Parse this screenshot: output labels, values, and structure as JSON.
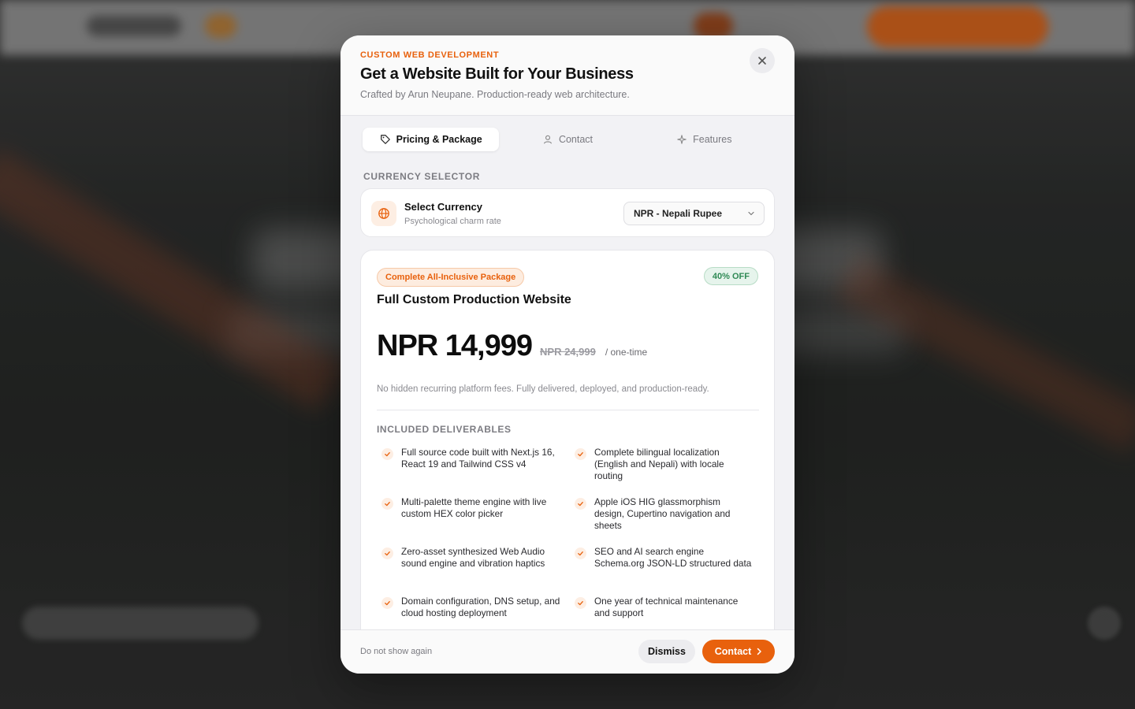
{
  "modal": {
    "eyebrow": "CUSTOM WEB DEVELOPMENT",
    "title": "Get a Website Built for Your Business",
    "subtitle": "Crafted by Arun Neupane. Production-ready web architecture.",
    "close_icon": "close-icon"
  },
  "tabs": [
    {
      "label": "Pricing & Package",
      "icon": "tag-icon",
      "active": true
    },
    {
      "label": "Contact",
      "icon": "user-icon",
      "active": false
    },
    {
      "label": "Features",
      "icon": "sparkle-icon",
      "active": false
    }
  ],
  "currency": {
    "section_label": "CURRENCY SELECTOR",
    "title": "Select Currency",
    "subtitle": "Psychological charm rate",
    "selected": "NPR - Nepali Rupee",
    "icon": "globe-icon"
  },
  "package": {
    "badge": "Complete All-Inclusive Package",
    "discount": "40% OFF",
    "name": "Full Custom Production Website",
    "price": "NPR 14,999",
    "old_price": "NPR 24,999",
    "period": "/ one-time",
    "note": "No hidden recurring platform fees. Fully delivered, deployed, and production-ready.",
    "deliverables_label": "INCLUDED DELIVERABLES",
    "deliverables": [
      "Full source code built with Next.js 16, React 19 and Tailwind CSS v4",
      "Complete bilingual localization (English and Nepali) with locale routing",
      "Multi-palette theme engine with live custom HEX color picker",
      "Apple iOS HIG glassmorphism design, Cupertino navigation and sheets",
      "Zero-asset synthesized Web Audio sound engine and vibration haptics",
      "SEO and AI search engine Schema.org JSON-LD structured data",
      "Domain configuration, DNS setup, and cloud hosting deployment",
      "One year of technical maintenance and support"
    ]
  },
  "footer": {
    "dont_show": "Do not show again",
    "dismiss": "Dismiss",
    "contact": "Contact"
  },
  "colors": {
    "accent": "#e8610d",
    "success": "#2f8a55"
  }
}
